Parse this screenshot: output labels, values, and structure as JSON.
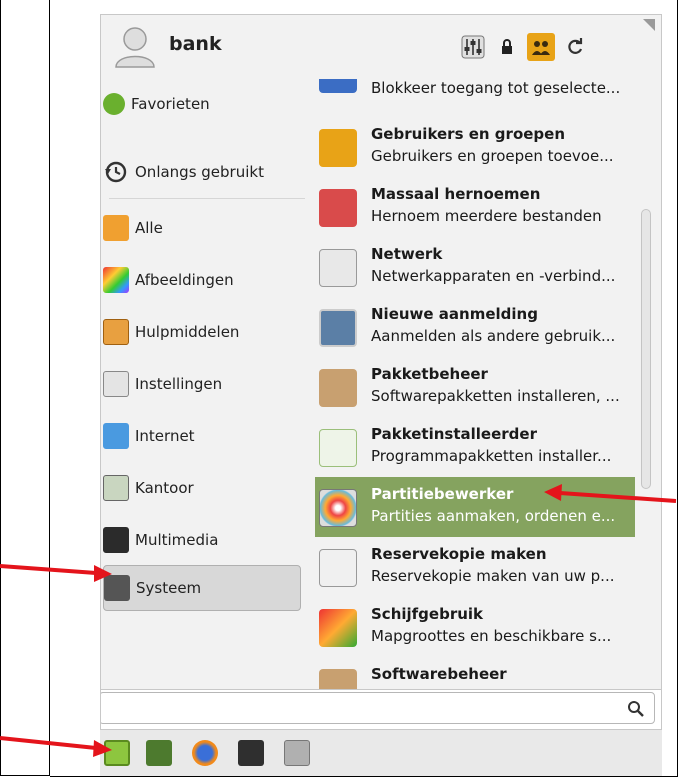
{
  "header": {
    "username": "bank",
    "buttons": [
      {
        "name": "settings-icon"
      },
      {
        "name": "lock-icon"
      },
      {
        "name": "users-icon"
      },
      {
        "name": "refresh-icon"
      }
    ]
  },
  "categories": [
    {
      "id": "favorieten",
      "label": "Favorieten",
      "icon": "info-icon"
    },
    {
      "id": "onlangs",
      "label": "Onlangs gebruikt",
      "icon": "history-icon"
    },
    {
      "id": "alle",
      "label": "Alle",
      "icon": "all-apps-icon"
    },
    {
      "id": "afbeeldingen",
      "label": "Afbeeldingen",
      "icon": "graphics-icon"
    },
    {
      "id": "hulpmiddelen",
      "label": "Hulpmiddelen",
      "icon": "accessories-icon"
    },
    {
      "id": "instellingen",
      "label": "Instellingen",
      "icon": "settings-icon"
    },
    {
      "id": "internet",
      "label": "Internet",
      "icon": "internet-icon"
    },
    {
      "id": "kantoor",
      "label": "Kantoor",
      "icon": "office-icon"
    },
    {
      "id": "multimedia",
      "label": "Multimedia",
      "icon": "multimedia-icon"
    },
    {
      "id": "systeem",
      "label": "Systeem",
      "icon": "system-icon",
      "selected": true
    }
  ],
  "apps": [
    {
      "title": "",
      "desc": "Blokkeer toegang tot geselecte...",
      "icon": "block-icon"
    },
    {
      "title": "Gebruikers en groepen",
      "desc": "Gebruikers en groepen toevoe...",
      "icon": "users-groups-icon"
    },
    {
      "title": "Massaal hernoemen",
      "desc": "Hernoem meerdere bestanden",
      "icon": "bulk-rename-icon"
    },
    {
      "title": "Netwerk",
      "desc": "Netwerkapparaten en -verbind...",
      "icon": "network-icon"
    },
    {
      "title": "Nieuwe aanmelding",
      "desc": "Aanmelden als andere gebruik...",
      "icon": "new-login-icon"
    },
    {
      "title": "Pakketbeheer",
      "desc": "Softwarepakketten installeren, ...",
      "icon": "package-manager-icon"
    },
    {
      "title": "Pakketinstalleerder",
      "desc": "Programmapakketten installer...",
      "icon": "package-installer-icon"
    },
    {
      "title": "Partitiebewerker",
      "desc": "Partities aanmaken, ordenen e...",
      "icon": "partition-editor-icon",
      "highlighted": true
    },
    {
      "title": "Reservekopie maken",
      "desc": "Reservekopie maken van uw p...",
      "icon": "backup-icon"
    },
    {
      "title": "Schijfgebruik",
      "desc": "Mapgroottes en beschikbare s...",
      "icon": "disk-usage-icon"
    },
    {
      "title": "Softwarebeheer",
      "desc": "",
      "icon": "software-manager-icon"
    }
  ],
  "search": {
    "placeholder": "",
    "value": ""
  },
  "taskbar": [
    {
      "name": "menu-icon"
    },
    {
      "name": "show-desktop-icon"
    },
    {
      "name": "firefox-icon"
    },
    {
      "name": "terminal-icon"
    },
    {
      "name": "files-icon"
    }
  ],
  "colors": {
    "highlight": "#85a35f",
    "arrow": "#e4141b",
    "selected_bg": "#d8d8d8"
  }
}
